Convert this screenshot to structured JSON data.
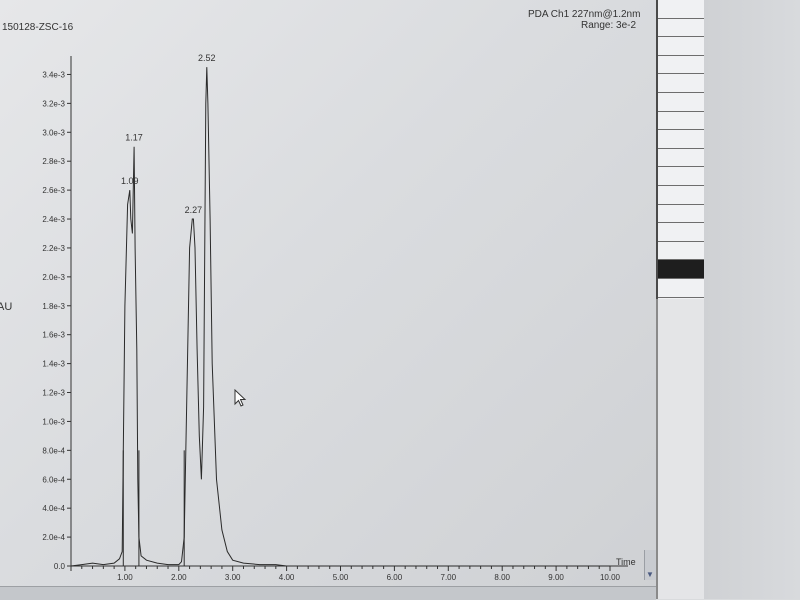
{
  "sample_id": "150128-ZSC-16",
  "channel": {
    "title": "PDA Ch1 227nm@1.2nm",
    "range": "Range: 3e-2"
  },
  "y_axis_label": "AU",
  "chart_data": {
    "type": "line",
    "title": "",
    "xlabel": "Time",
    "ylabel": "AU",
    "xlim": [
      0.0,
      10.0
    ],
    "ylim": [
      0.0,
      0.0035
    ],
    "x_ticks": [
      "1.00",
      "2.00",
      "3.00",
      "4.00",
      "5.00",
      "6.00",
      "7.00",
      "8.00",
      "9.00",
      "10.00"
    ],
    "y_ticks": [
      "0.0",
      "2.0e-4",
      "4.0e-4",
      "6.0e-4",
      "8.0e-4",
      "1.0e-3",
      "1.2e-3",
      "1.4e-3",
      "1.6e-3",
      "1.8e-3",
      "2.0e-3",
      "2.2e-3",
      "2.4e-3",
      "2.6e-3",
      "2.8e-3",
      "3.0e-3",
      "3.2e-3",
      "3.4e-3"
    ],
    "series": [
      {
        "x": [
          0.0,
          0.2,
          0.4,
          0.6,
          0.8,
          0.9,
          0.95,
          0.97,
          1.0,
          1.05,
          1.09,
          1.11,
          1.14,
          1.17,
          1.19,
          1.22,
          1.24,
          1.26,
          1.3,
          1.4,
          1.6,
          1.8,
          2.0,
          2.05,
          2.1,
          2.15,
          2.2,
          2.25,
          2.27,
          2.3,
          2.34,
          2.38,
          2.42,
          2.46,
          2.5,
          2.52,
          2.54,
          2.58,
          2.62,
          2.7,
          2.8,
          2.9,
          3.0,
          3.2,
          3.5,
          3.8,
          4.0,
          4.5,
          5.0,
          6.0,
          7.0,
          8.0,
          9.0,
          10.0
        ],
        "y": [
          0.0,
          1e-05,
          2e-05,
          1e-05,
          2e-05,
          5e-05,
          0.0001,
          0.0008,
          0.0018,
          0.0025,
          0.0026,
          0.0024,
          0.0023,
          0.0029,
          0.0022,
          0.0015,
          0.0006,
          0.0002,
          7e-05,
          4e-05,
          2e-05,
          1e-05,
          1e-05,
          3e-05,
          0.0002,
          0.0012,
          0.0022,
          0.0024,
          0.0024,
          0.0022,
          0.0015,
          0.0009,
          0.0006,
          0.0011,
          0.0032,
          0.00345,
          0.0032,
          0.0024,
          0.0014,
          0.0006,
          0.00025,
          0.0001,
          4e-05,
          2e-05,
          1e-05,
          1e-05,
          0.0,
          0.0,
          0.0,
          0.0,
          0.0,
          0.0,
          0.0,
          0.0
        ]
      }
    ],
    "peaks": [
      {
        "label": "1.09",
        "x": 1.09,
        "y": 0.0026
      },
      {
        "label": "1.17",
        "x": 1.17,
        "y": 0.0029
      },
      {
        "label": "2.27",
        "x": 2.27,
        "y": 0.0024
      },
      {
        "label": "2.52",
        "x": 2.52,
        "y": 0.00345
      }
    ]
  }
}
